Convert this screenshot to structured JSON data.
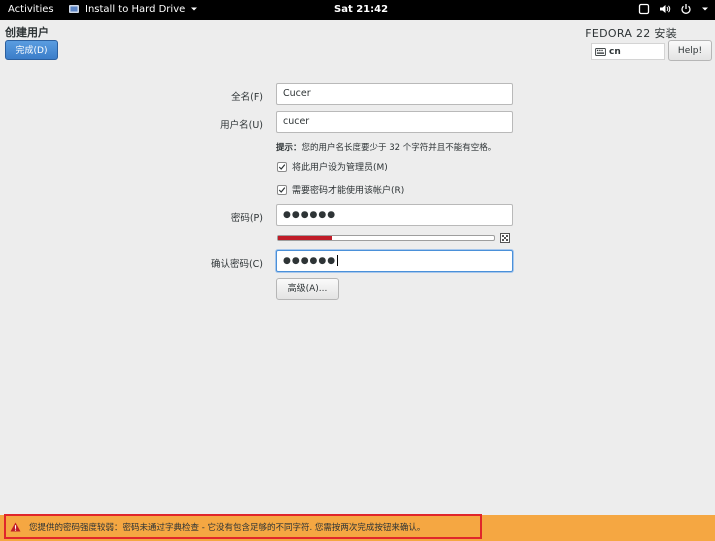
{
  "topbar": {
    "activities": "Activities",
    "app_title": "Install to Hard Drive",
    "clock": "Sat 21:42"
  },
  "header": {
    "title": "创建用户",
    "done_label": "完成(D)",
    "product": "FEDORA 22 安装",
    "keyboard_layout": "cn",
    "help_label": "Help!"
  },
  "form": {
    "fullname_label": "全名(F)",
    "fullname_value": "Cucer",
    "username_label": "用户名(U)",
    "username_value": "cucer",
    "hint_prefix": "提示：",
    "hint_text": "您的用户名长度要少于 32 个字符并且不能有空格。",
    "admin_checkbox": {
      "label": "将此用户设为管理员(M)",
      "checked": true
    },
    "require_password_checkbox": {
      "label": "需要密码才能使用该帐户(R)",
      "checked": true
    },
    "password_label": "密码(P)",
    "password_value": "●●●●●●",
    "password_strength": 0.25,
    "strength_color": "#c01c28",
    "confirm_label": "确认密码(C)",
    "confirm_value": "●●●●●●",
    "advanced_label": "高级(A)..."
  },
  "warning": {
    "text": "您提供的密码强度较弱：密码未通过字典检查 - 它没有包含足够的不同字符. 您需按两次完成按钮来确认。",
    "bar_color": "#f5a742",
    "border_color": "#e0262b"
  }
}
